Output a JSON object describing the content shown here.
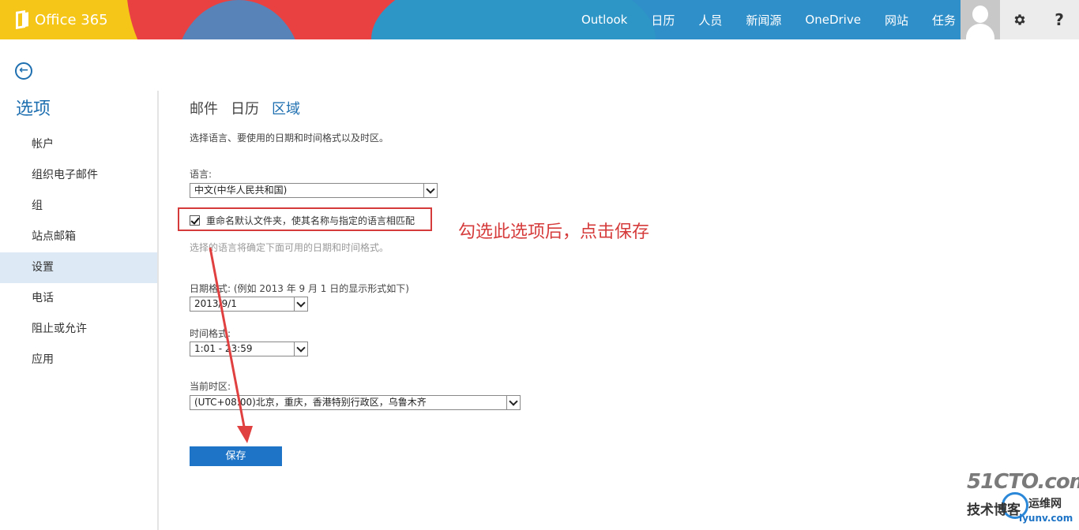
{
  "header": {
    "brand": "Office 365",
    "nav": [
      "Outlook",
      "日历",
      "人员",
      "新闻源",
      "OneDrive",
      "网站",
      "任务"
    ],
    "gear_icon": "gear-icon",
    "help_label": "?"
  },
  "sidebar": {
    "back_glyph": "←",
    "title": "选项",
    "items": [
      "帐户",
      "组织电子邮件",
      "组",
      "站点邮箱",
      "设置",
      "电话",
      "阻止或允许",
      "应用"
    ],
    "active_index": 4
  },
  "main": {
    "tabs": [
      "邮件",
      "日历",
      "区域"
    ],
    "selected_tab": "区域",
    "description": "选择语言、要使用的日期和时间格式以及时区。",
    "language": {
      "label": "语言:",
      "value": "中文(中华人民共和国)"
    },
    "rename_folders": {
      "checked": true,
      "label": "重命名默认文件夹，使其名称与指定的语言相匹配"
    },
    "language_note": "选择的语言将确定下面可用的日期和时间格式。",
    "date_format": {
      "label": "日期格式: (例如 2013 年 9 月 1 日的显示形式如下)",
      "value": "2013/9/1"
    },
    "time_format": {
      "label": "时间格式:",
      "value": "1:01 - 23:59"
    },
    "timezone": {
      "label": "当前时区:",
      "value": "(UTC+08:00)北京，重庆，香港特别行政区，乌鲁木齐"
    },
    "save_label": "保存"
  },
  "annotation": {
    "text": "勾选此选项后，点击保存",
    "color": "#d63b3b"
  },
  "watermark": {
    "line1": "51CTO.com",
    "line2": "技术博客",
    "line3": "运维网",
    "line4": "iyunv.com"
  },
  "colors": {
    "accent": "#1e6fb0",
    "save_button": "#1e74c6",
    "topbar": "#2f8fc8"
  }
}
